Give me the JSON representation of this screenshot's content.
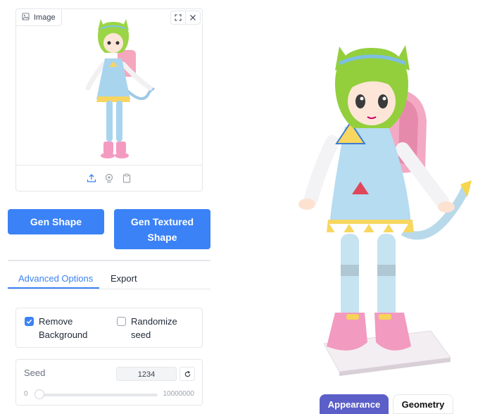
{
  "image_panel": {
    "label": "Image",
    "icons": [
      "image-icon",
      "fullscreen-icon",
      "close-icon",
      "upload-icon",
      "webcam-icon",
      "clipboard-icon"
    ]
  },
  "buttons": {
    "gen_shape": "Gen Shape",
    "gen_textured_line1": "Gen Textured",
    "gen_textured_line2": "Shape"
  },
  "tabs": [
    {
      "label": "Advanced Options",
      "active": true
    },
    {
      "label": "Export",
      "active": false
    }
  ],
  "options": {
    "remove_bg_line1": "Remove",
    "remove_bg_line2": "Background",
    "remove_bg_checked": true,
    "randomize_line1": "Randomize",
    "randomize_line2": "seed",
    "randomize_checked": false
  },
  "seed": {
    "label": "Seed",
    "value": "1234",
    "min": "0",
    "max": "10000000",
    "slider_fraction": 0.0001234
  },
  "viewer": {
    "appearance_label": "Appearance",
    "geometry_label": "Geometry",
    "active_mode": "Appearance"
  },
  "colors": {
    "primary": "#3b82f6",
    "appearance_active": "#5b5fc7",
    "border": "#e5e7eb"
  }
}
